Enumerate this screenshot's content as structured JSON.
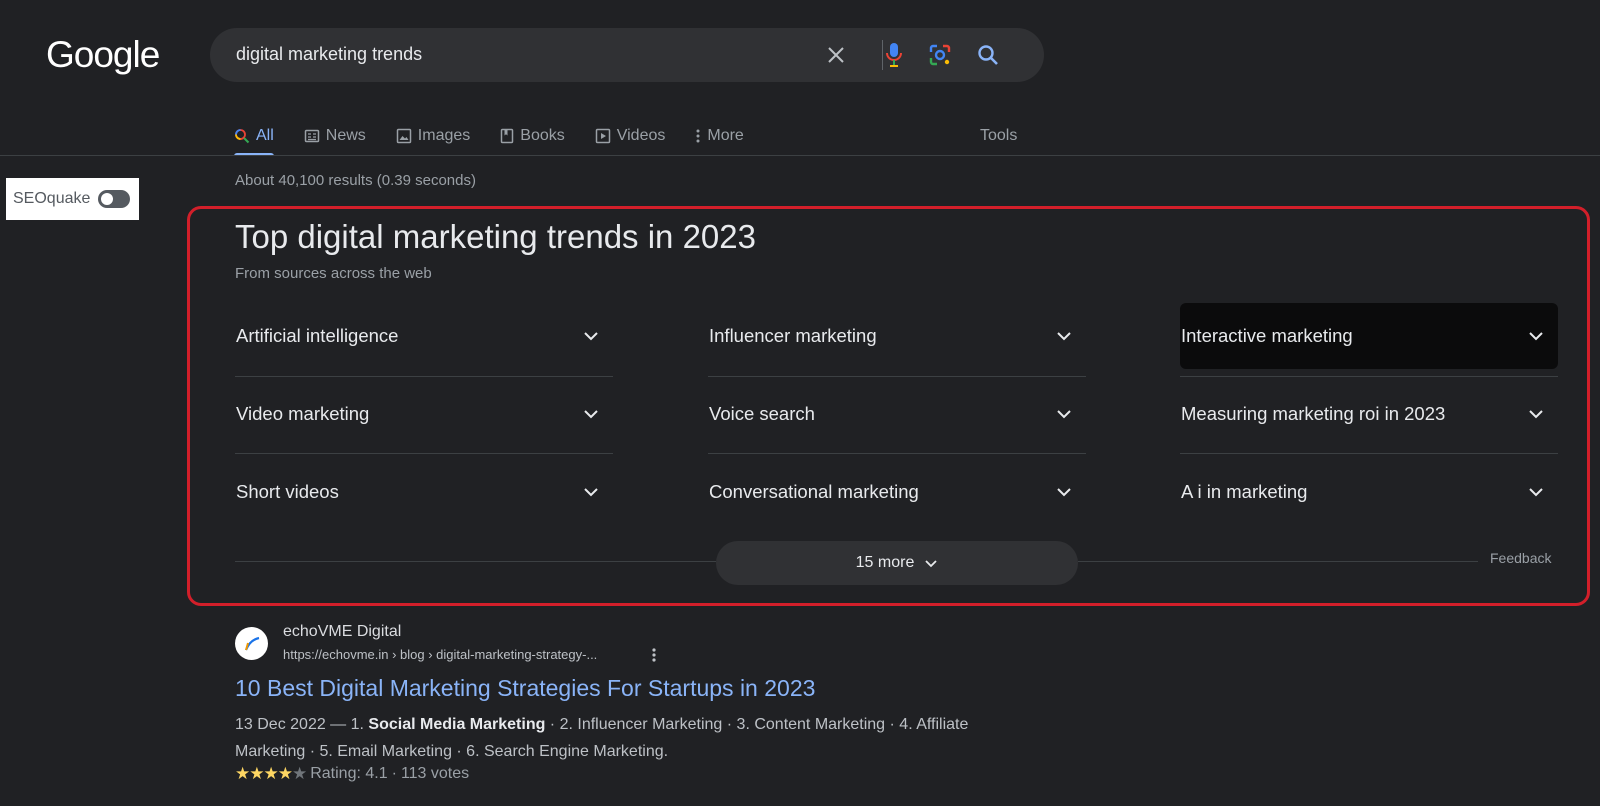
{
  "logo": "Google",
  "search": {
    "query": "digital marketing trends"
  },
  "tabs": [
    {
      "label": "All",
      "icon": "search-icon",
      "active": true
    },
    {
      "label": "News",
      "icon": "news-icon"
    },
    {
      "label": "Images",
      "icon": "image-icon"
    },
    {
      "label": "Books",
      "icon": "book-icon"
    },
    {
      "label": "Videos",
      "icon": "video-icon"
    },
    {
      "label": "More",
      "icon": "more-vert-icon"
    }
  ],
  "tools_label": "Tools",
  "seoquake": {
    "label": "SEOquake",
    "enabled": false
  },
  "result_stats": "About 40,100 results (0.39 seconds)",
  "panel": {
    "title": "Top digital marketing trends in 2023",
    "subtitle": "From sources across the web",
    "items": [
      [
        "Artificial intelligence",
        "Influencer marketing",
        "Interactive marketing"
      ],
      [
        "Video marketing",
        "Voice search",
        "Measuring marketing roi in 2023"
      ],
      [
        "Short videos",
        "Conversational marketing",
        "A i in marketing"
      ]
    ],
    "more_label": "15 more",
    "feedback": "Feedback"
  },
  "result": {
    "site_name": "echoVME Digital",
    "url": "https://echovme.in › blog › digital-marketing-strategy-...",
    "title": "10 Best Digital Marketing Strategies For Startups in 2023",
    "snippet_date": "13 Dec 2022 — 1. ",
    "snippet_bold": "Social Media Marketing",
    "snippet_rest": " · 2. Influencer Marketing · 3. Content Marketing · 4. Affiliate Marketing · 5. Email Marketing · 6. Search Engine Marketing.",
    "rating_label": "Rating: 4.1",
    "votes": "113 votes",
    "rating": 4.1,
    "rating_max": 5
  },
  "colors": {
    "background": "#202124",
    "accent": "#8ab4f8",
    "highlight_border": "#d21f2a"
  }
}
